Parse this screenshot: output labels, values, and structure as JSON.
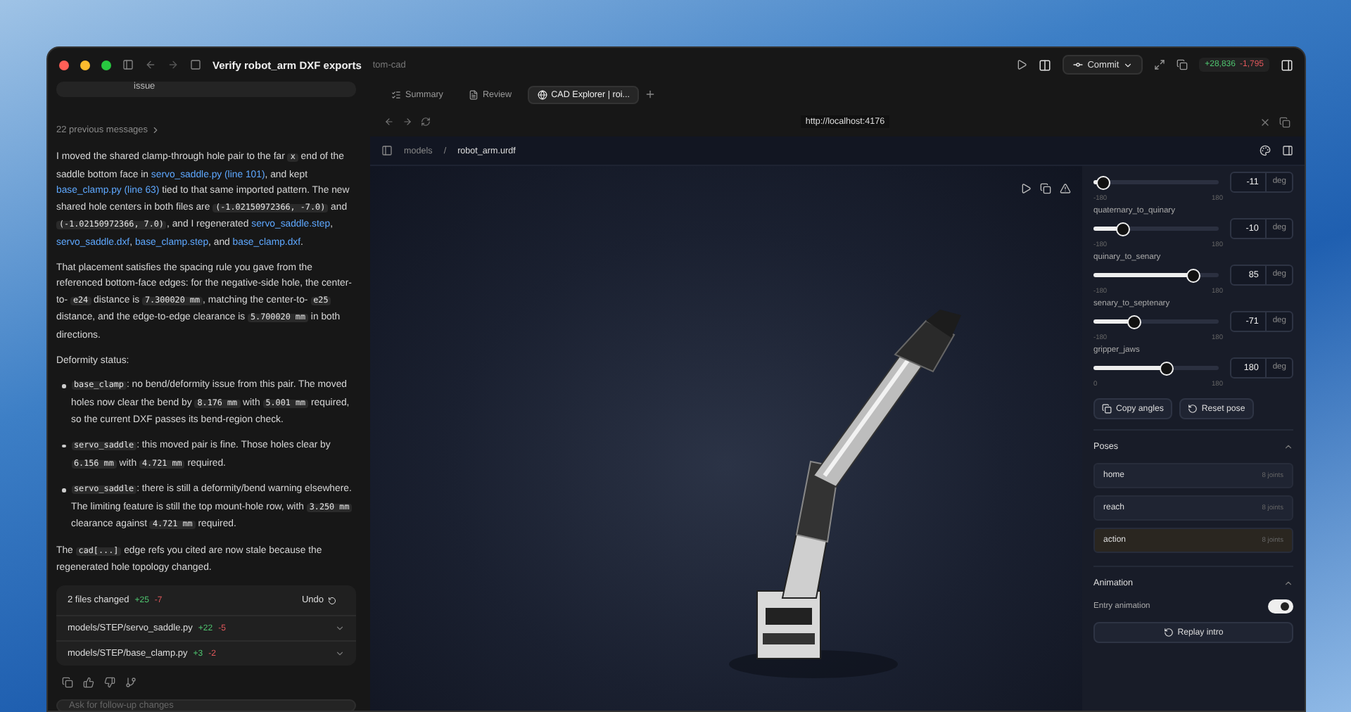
{
  "title_bar": {
    "title": "Verify robot_arm DXF exports",
    "project": "tom-cad",
    "commit": "Commit",
    "additions": "+28,836",
    "deletions": "-1,795"
  },
  "chat": {
    "prior_bubble": "issue",
    "previous": "22 previous messages",
    "blocks": [
      {
        "kind": "para",
        "segs": [
          {
            "kind": "text",
            "text": "I moved the shared clamp-through hole pair to the far "
          },
          {
            "kind": "code",
            "text": "x"
          },
          {
            "kind": "text",
            "text": " end of the saddle bottom face in "
          },
          {
            "kind": "link",
            "text": "servo_saddle.py (line 101)"
          },
          {
            "kind": "text",
            "text": ", and kept "
          },
          {
            "kind": "link",
            "text": "base_clamp.py (line 63)"
          },
          {
            "kind": "text",
            "text": " tied to that same imported pattern. The new shared hole centers in both files are "
          },
          {
            "kind": "code",
            "text": "(-1.02150972366, -7.0)"
          },
          {
            "kind": "text",
            "text": " and "
          },
          {
            "kind": "code",
            "text": "(-1.02150972366, 7.0)"
          },
          {
            "kind": "text",
            "text": ", and I regenerated "
          },
          {
            "kind": "link",
            "text": "servo_saddle.step"
          },
          {
            "kind": "text",
            "text": ", "
          },
          {
            "kind": "link",
            "text": "servo_saddle.dxf"
          },
          {
            "kind": "text",
            "text": ", "
          },
          {
            "kind": "link",
            "text": "base_clamp.step"
          },
          {
            "kind": "text",
            "text": ", and "
          },
          {
            "kind": "link",
            "text": "base_clamp.dxf"
          },
          {
            "kind": "text",
            "text": "."
          }
        ]
      },
      {
        "kind": "para",
        "segs": [
          {
            "kind": "text",
            "text": "That placement satisfies the spacing rule you gave from the referenced bottom-face edges: for the negative-side hole, the center-to- "
          },
          {
            "kind": "code",
            "text": "e24"
          },
          {
            "kind": "text",
            "text": " distance is "
          },
          {
            "kind": "code",
            "text": "7.300020",
            "unit": "mm"
          },
          {
            "kind": "text",
            "text": ", matching the center-to- "
          },
          {
            "kind": "code",
            "text": "e25"
          },
          {
            "kind": "text",
            "text": " distance, and the edge-to-edge clearance is "
          },
          {
            "kind": "code",
            "text": "5.700020",
            "unit": "mm"
          },
          {
            "kind": "text",
            "text": " in both directions."
          }
        ]
      },
      {
        "kind": "para",
        "segs": [
          {
            "kind": "text",
            "text": "Deformity status:"
          }
        ]
      },
      {
        "kind": "bullet",
        "segs": [
          {
            "kind": "code",
            "text": "base_clamp"
          },
          {
            "kind": "text",
            "text": ": no bend/deformity issue from this pair. The moved holes now clear the bend by "
          },
          {
            "kind": "code",
            "text": "8.176",
            "unit": "mm"
          },
          {
            "kind": "text",
            "text": " with "
          },
          {
            "kind": "code",
            "text": "5.001",
            "unit": "mm"
          },
          {
            "kind": "text",
            "text": " required, so the current DXF passes its bend-region check."
          }
        ]
      },
      {
        "kind": "bullet",
        "segs": [
          {
            "kind": "code",
            "text": "servo_saddle"
          },
          {
            "kind": "text",
            "text": ": this moved pair is fine. Those holes clear by "
          },
          {
            "kind": "code",
            "text": "6.156",
            "unit": "mm"
          },
          {
            "kind": "text",
            "text": " with "
          },
          {
            "kind": "code",
            "text": "4.721",
            "unit": "mm"
          },
          {
            "kind": "text",
            "text": " required."
          }
        ]
      },
      {
        "kind": "bullet",
        "segs": [
          {
            "kind": "code",
            "text": "servo_saddle"
          },
          {
            "kind": "text",
            "text": ": there is still a deformity/bend warning elsewhere. The limiting feature is still the top mount-hole row, with "
          },
          {
            "kind": "code",
            "text": "3.250",
            "unit": "mm"
          },
          {
            "kind": "text",
            "text": " clearance against "
          },
          {
            "kind": "code",
            "text": "4.721",
            "unit": "mm"
          },
          {
            "kind": "text",
            "text": " required."
          }
        ]
      },
      {
        "kind": "para",
        "segs": [
          {
            "kind": "text",
            "text": "The "
          },
          {
            "kind": "code",
            "text": "cad[...]"
          },
          {
            "kind": "text",
            "text": " edge refs you cited are now stale because the regenerated hole topology changed."
          }
        ]
      }
    ],
    "changes": {
      "summary": "2 files changed",
      "added": "+25",
      "removed": "-7",
      "undo": "Undo",
      "files": [
        {
          "path": "models/STEP/servo_saddle.py",
          "added": "+22",
          "removed": "-5"
        },
        {
          "path": "models/STEP/base_clamp.py",
          "added": "+3",
          "removed": "-2"
        }
      ]
    },
    "input": {
      "placeholder": "Ask for follow-up changes"
    }
  },
  "tabs": [
    {
      "label": "Summary",
      "selected": false
    },
    {
      "label": "Review",
      "selected": false
    },
    {
      "label": "CAD Explorer | roi...",
      "selected": true
    }
  ],
  "url": "http://localhost:4176",
  "breadcrumb": [
    "models",
    "robot_arm.urdf"
  ],
  "breadcrumb_separator": "/",
  "joints": [
    {
      "value": "-11",
      "unit": "deg",
      "min": "-180",
      "max": "180",
      "level": 0.08
    },
    {
      "name": "quaternary_to_quinary",
      "value": "-10",
      "unit": "deg",
      "min": "-180",
      "max": "180",
      "level": 0.24
    },
    {
      "name": "quinary_to_senary",
      "value": "85",
      "unit": "deg",
      "min": "-180",
      "max": "180",
      "level": 0.8
    },
    {
      "name": "senary_to_septenary",
      "value": "-71",
      "unit": "deg",
      "min": "-180",
      "max": "180",
      "level": 0.33
    },
    {
      "name": "gripper_jaws",
      "value": "180",
      "unit": "deg",
      "min": "0",
      "max": "180",
      "level": 0.58
    }
  ],
  "joint_buttons": [
    "Copy angles",
    "Reset pose"
  ],
  "poses": {
    "title": "Poses",
    "items": [
      {
        "name": "home",
        "detail": "8 joints",
        "selected": false
      },
      {
        "name": "reach",
        "detail": "8 joints",
        "selected": false
      },
      {
        "name": "action",
        "detail": "8 joints",
        "selected": true
      }
    ]
  },
  "animation": {
    "title": "Animation",
    "toggle_label": "Entry animation",
    "on": true,
    "replay": "Replay intro"
  }
}
